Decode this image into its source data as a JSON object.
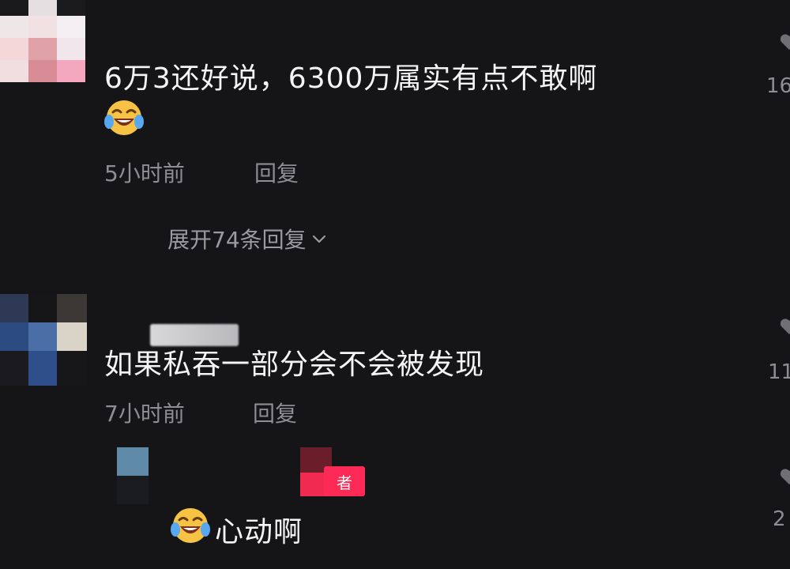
{
  "comments": [
    {
      "text": "6万3还好说，6300万属实有点不敢啊",
      "time": "5小时前",
      "reply_label": "回复",
      "likes": "16",
      "emoji": "laughing-crying-emoji"
    },
    {
      "text": "如果私吞一部分会不会被发现",
      "time": "7小时前",
      "reply_label": "回复",
      "likes": "11"
    }
  ],
  "expand_replies": {
    "label": "展开74条回复",
    "icon": "chevron-down-icon"
  },
  "reply": {
    "text": "心动啊",
    "badge": "者",
    "likes": "2",
    "emoji": "laughing-crying-emoji"
  },
  "colors": {
    "background": "#151417",
    "text": "#f4f4f4",
    "meta": "#8d8d92",
    "author_badge": "#fd2a55"
  }
}
